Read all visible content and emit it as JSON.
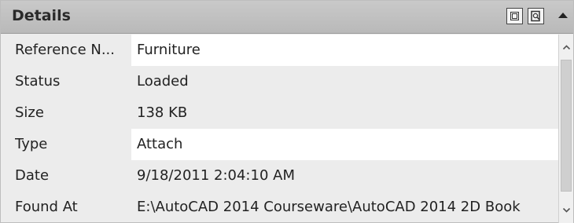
{
  "panel": {
    "title": "Details",
    "header_buttons": [
      {
        "icon": "preview-icon"
      },
      {
        "icon": "details-icon"
      }
    ],
    "collapse_icon": "chevron-up-icon"
  },
  "rows": [
    {
      "label": "Reference N...",
      "value": "Furniture"
    },
    {
      "label": "Status",
      "value": "Loaded"
    },
    {
      "label": "Size",
      "value": "138 KB"
    },
    {
      "label": "Type",
      "value": "Attach"
    },
    {
      "label": "Date",
      "value": "9/18/2011 2:04:10 AM"
    },
    {
      "label": "Found At",
      "value": "E:\\AutoCAD 2014 Courseware\\AutoCAD 2014 2D Book"
    }
  ],
  "colors": {
    "header_bg": "#c1c1c1",
    "panel_bg": "#ececec",
    "editable_bg": "#ffffff"
  }
}
